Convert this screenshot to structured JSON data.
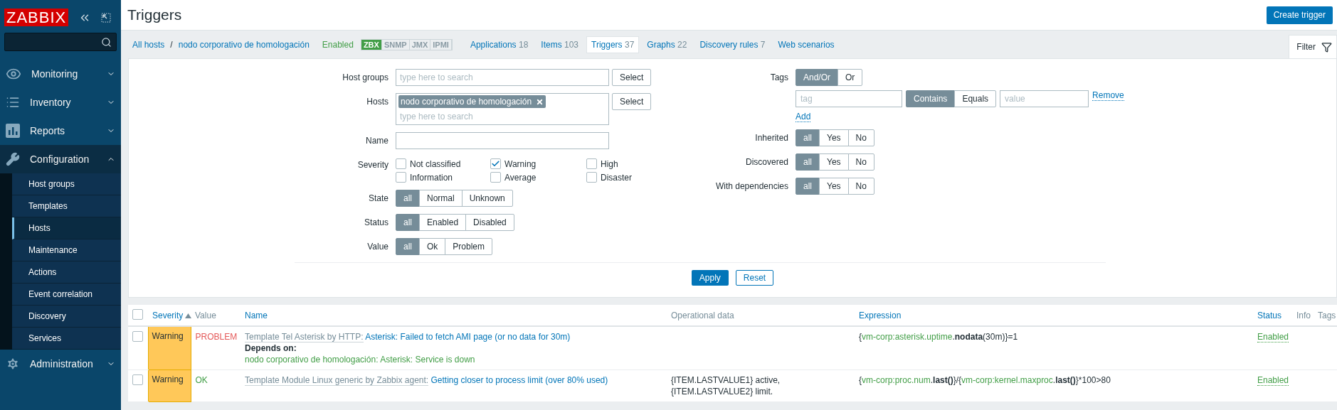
{
  "sidebar": {
    "logo": "ZABBIX",
    "menu": [
      {
        "label": "Monitoring",
        "expanded": false
      },
      {
        "label": "Inventory",
        "expanded": false
      },
      {
        "label": "Reports",
        "expanded": false
      },
      {
        "label": "Configuration",
        "expanded": true,
        "children": [
          {
            "label": "Host groups",
            "selected": false
          },
          {
            "label": "Templates",
            "selected": false
          },
          {
            "label": "Hosts",
            "selected": true
          },
          {
            "label": "Maintenance",
            "selected": false
          },
          {
            "label": "Actions",
            "selected": false
          },
          {
            "label": "Event correlation",
            "selected": false
          },
          {
            "label": "Discovery",
            "selected": false
          },
          {
            "label": "Services",
            "selected": false
          }
        ]
      },
      {
        "label": "Administration",
        "expanded": false
      }
    ]
  },
  "header": {
    "title": "Triggers",
    "button": "Create trigger"
  },
  "nav": {
    "breadcrumbs": [
      "All hosts",
      "nodo corporativo de homologación"
    ],
    "separator": "/",
    "status": "Enabled",
    "availability": [
      {
        "label": "ZBX",
        "on": true
      },
      {
        "label": "SNMP",
        "on": false
      },
      {
        "label": "JMX",
        "on": false
      },
      {
        "label": "IPMI",
        "on": false
      }
    ],
    "tabs": [
      {
        "label": "Applications",
        "count": "18",
        "selected": false
      },
      {
        "label": "Items",
        "count": "103",
        "selected": false
      },
      {
        "label": "Triggers",
        "count": "37",
        "selected": true
      },
      {
        "label": "Graphs",
        "count": "22",
        "selected": false
      },
      {
        "label": "Discovery rules",
        "count": "7",
        "selected": false
      },
      {
        "label": "Web scenarios",
        "selected": false
      }
    ],
    "filter_tab": "Filter"
  },
  "filter": {
    "left": [
      {
        "kind": "multiselect",
        "label": "Host groups",
        "placeholder": "type here to search",
        "button": "Select"
      },
      {
        "kind": "multiselect",
        "label": "Hosts",
        "tags": [
          "nodo corporativo de homologación"
        ],
        "placeholder": "type here to search",
        "button": "Select"
      },
      {
        "kind": "text",
        "label": "Name"
      },
      {
        "kind": "checkboxes",
        "label": "Severity",
        "options": [
          {
            "label": "Not classified",
            "checked": false
          },
          {
            "label": "Warning",
            "checked": true
          },
          {
            "label": "High",
            "checked": false
          },
          {
            "label": "Information",
            "checked": false
          },
          {
            "label": "Average",
            "checked": false
          },
          {
            "label": "Disaster",
            "checked": false
          }
        ]
      },
      {
        "kind": "segmented",
        "label": "State",
        "options": [
          {
            "label": "all",
            "selected": true
          },
          {
            "label": "Normal",
            "selected": false
          },
          {
            "label": "Unknown",
            "selected": false
          }
        ]
      },
      {
        "kind": "segmented",
        "label": "Status",
        "options": [
          {
            "label": "all",
            "selected": true
          },
          {
            "label": "Enabled",
            "selected": false
          },
          {
            "label": "Disabled",
            "selected": false
          }
        ]
      },
      {
        "kind": "segmented",
        "label": "Value",
        "options": [
          {
            "label": "all",
            "selected": true
          },
          {
            "label": "Ok",
            "selected": false
          },
          {
            "label": "Problem",
            "selected": false
          }
        ]
      }
    ],
    "right": [
      {
        "kind": "tags",
        "label": "Tags",
        "options": [
          {
            "label": "And/Or",
            "selected": true
          },
          {
            "label": "Or",
            "selected": false
          }
        ],
        "tag_placeholder": "tag",
        "operators": [
          {
            "label": "Contains",
            "selected": true
          },
          {
            "label": "Equals",
            "selected": false
          }
        ],
        "value_placeholder": "value",
        "remove": "Remove",
        "add": "Add"
      },
      {
        "kind": "segmented",
        "label": "Inherited",
        "options": [
          {
            "label": "all",
            "selected": true
          },
          {
            "label": "Yes",
            "selected": false
          },
          {
            "label": "No",
            "selected": false
          }
        ]
      },
      {
        "kind": "segmented",
        "label": "Discovered",
        "options": [
          {
            "label": "all",
            "selected": true
          },
          {
            "label": "Yes",
            "selected": false
          },
          {
            "label": "No",
            "selected": false
          }
        ]
      },
      {
        "kind": "segmented",
        "label": "With dependencies",
        "options": [
          {
            "label": "all",
            "selected": true
          },
          {
            "label": "Yes",
            "selected": false
          },
          {
            "label": "No",
            "selected": false
          }
        ]
      }
    ],
    "apply": "Apply",
    "reset": "Reset"
  },
  "table": {
    "select_all": false,
    "columns": [
      "Severity",
      "Value",
      "Name",
      "Operational data",
      "Expression",
      "Status",
      "Info",
      "Tags"
    ],
    "rows": [
      {
        "checked": false,
        "severity": "Warning",
        "color": "#ffc859",
        "value": {
          "text": "PROBLEM",
          "color": "#e45959"
        },
        "template": "Template Tel Asterisk by HTTP:",
        "name": "Asterisk: Failed to fetch AMI page (or no data for 30m)",
        "depends_label": "Depends on:",
        "depends": "nodo corporativo de homologación: Asterisk: Service is down",
        "expression": [
          {
            "kind": "plain",
            "text": "{"
          },
          {
            "kind": "link",
            "text": "vm-corp:asterisk.uptime"
          },
          {
            "kind": "plain",
            "text": "."
          },
          {
            "kind": "func",
            "text": "nodata"
          },
          {
            "kind": "plain",
            "text": "(30m)}=1"
          }
        ],
        "status": "Enabled"
      },
      {
        "checked": false,
        "severity": "Warning",
        "color": "#ffc859",
        "value": {
          "text": "OK",
          "color": "#429e47"
        },
        "template": "Template Module Linux generic by Zabbix agent:",
        "name": "Getting closer to process limit (over 80% used)",
        "operational_data": "{ITEM.LASTVALUE1} active, {ITEM.LASTVALUE2} limit.",
        "expression": [
          {
            "kind": "plain",
            "text": "{"
          },
          {
            "kind": "link",
            "text": "vm-corp:proc.num"
          },
          {
            "kind": "plain",
            "text": "."
          },
          {
            "kind": "func",
            "text": "last()"
          },
          {
            "kind": "plain",
            "text": "}/{"
          },
          {
            "kind": "link",
            "text": "vm-corp:kernel.maxproc"
          },
          {
            "kind": "plain",
            "text": "."
          },
          {
            "kind": "func",
            "text": "last()"
          },
          {
            "kind": "plain",
            "text": "}*100>80"
          }
        ],
        "status": "Enabled"
      }
    ]
  }
}
